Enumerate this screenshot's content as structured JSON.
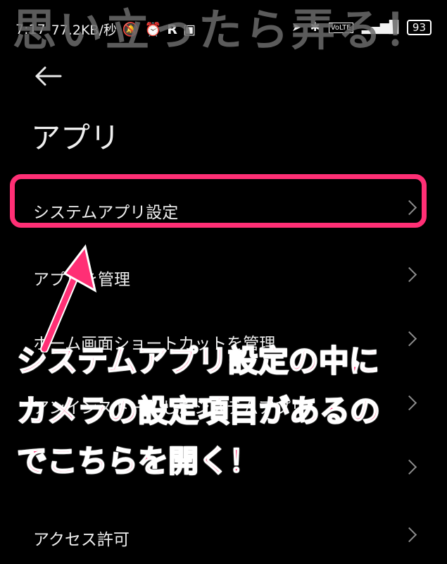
{
  "status_bar": {
    "time": "7:17",
    "speed": "77.2KB/秒",
    "icons_left": [
      "bell-icon",
      "alarm-icon",
      "r-icon",
      "square-icon"
    ],
    "icons_right": [
      "location-icon",
      "bluetooth-icon",
      "volte-icon",
      "signal-icon"
    ],
    "battery": "93"
  },
  "watermark": "思い立ったら弄る！",
  "page": {
    "title": "アプリ"
  },
  "menu": [
    {
      "label": "システムアプリ設定"
    },
    {
      "label": "アプリを管理"
    },
    {
      "label": "ホーム画面ショートカットを管理"
    },
    {
      "label": "アンインストールしたシステムアプリ"
    },
    {
      "label": ""
    },
    {
      "label": "アクセス許可"
    }
  ],
  "annotation": {
    "text": "システムアプリ設定の中に\nカメラの設定項目があるの\nでこちらを開く！",
    "accent": "#ff2f75"
  }
}
